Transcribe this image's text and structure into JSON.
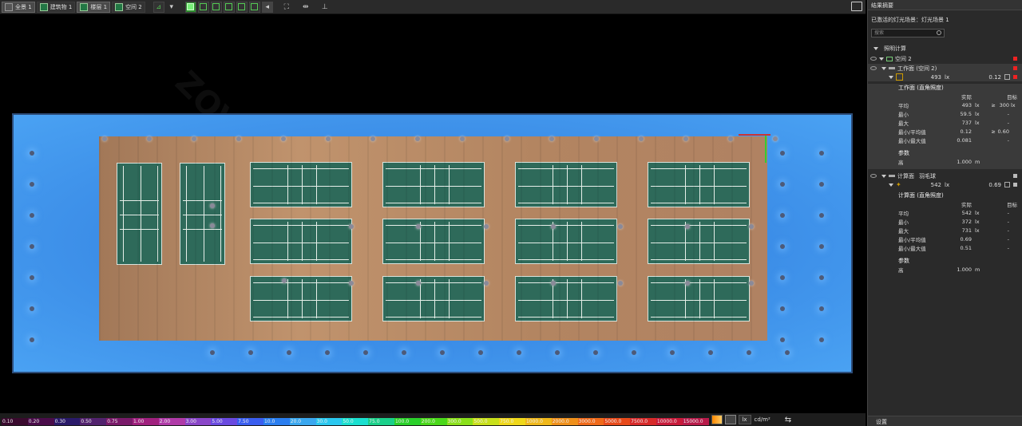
{
  "toolbar": {
    "items": [
      {
        "label": "全景 1"
      },
      {
        "label": "建筑物 1"
      },
      {
        "label": "楼层 1"
      },
      {
        "label": "空间 2"
      }
    ]
  },
  "panel": {
    "title": "结果摘要",
    "active_scene": "已激活的灯光场景：灯光场景 1",
    "search_placeholder": "搜索",
    "section": "照明计算",
    "space_name": "空间 2",
    "workplane": {
      "name": "工作面 (空间 2)",
      "summary_value": "493",
      "summary_unit": "lx",
      "summary_ratio": "0.12",
      "table_title": "工作面 (直角照度)",
      "col_actual": "实际",
      "col_target": "目标",
      "rows": [
        {
          "k": "平均",
          "v": "493",
          "u": "lx",
          "c": "≥",
          "t": "300",
          "tu": "lx"
        },
        {
          "k": "最小",
          "v": "59.5",
          "u": "lx",
          "c": "",
          "t": "-",
          "tu": ""
        },
        {
          "k": "最大",
          "v": "737",
          "u": "lx",
          "c": "",
          "t": "-",
          "tu": ""
        },
        {
          "k": "最小/平均值",
          "v": "0.12",
          "u": "",
          "c": "≥",
          "t": "0.60",
          "tu": ""
        },
        {
          "k": "最小/最大值",
          "v": "0.081",
          "u": "",
          "c": "",
          "t": "-",
          "tu": ""
        }
      ],
      "params_title": "参数",
      "height_label": "高",
      "height_value": "1.000",
      "height_unit": "m"
    },
    "calcplane": {
      "name": "计算面",
      "type": "羽毛球",
      "summary_value": "542",
      "summary_unit": "lx",
      "summary_ratio": "0.69",
      "table_title": "计算面 (直角照度)",
      "col_actual": "实际",
      "col_target": "目标",
      "rows": [
        {
          "k": "平均",
          "v": "542",
          "u": "lx",
          "c": "",
          "t": "-",
          "tu": ""
        },
        {
          "k": "最小",
          "v": "372",
          "u": "lx",
          "c": "",
          "t": "-",
          "tu": ""
        },
        {
          "k": "最大",
          "v": "731",
          "u": "lx",
          "c": "",
          "t": "-",
          "tu": ""
        },
        {
          "k": "最小/平均值",
          "v": "0.69",
          "u": "",
          "c": "",
          "t": "-",
          "tu": ""
        },
        {
          "k": "最小/最大值",
          "v": "0.51",
          "u": "",
          "c": "",
          "t": "-",
          "tu": ""
        }
      ],
      "params_title": "参数",
      "height_label": "高",
      "height_value": "1.000",
      "height_unit": "m"
    },
    "settings": "设置"
  },
  "legend": {
    "values": [
      "0.10",
      "0.20",
      "0.30",
      "0.50",
      "0.75",
      "1.00",
      "2.00",
      "3.00",
      "5.00",
      "7.50",
      "10.0",
      "20.0",
      "30.0",
      "50.0",
      "75.0",
      "100.0",
      "200.0",
      "300.0",
      "500.0",
      "750.0",
      "1000.0",
      "2000.0",
      "3000.0",
      "5000.0",
      "7500.0",
      "10000.0",
      "15000.0"
    ],
    "colors": [
      "#3a0a2e",
      "#4a0c4a",
      "#2a1a6a",
      "#52226e",
      "#7a1a6a",
      "#a0207e",
      "#b03aa8",
      "#8a46c8",
      "#6a4ae0",
      "#3a5ef0",
      "#2a7ef0",
      "#3aa8f0",
      "#2ac8f0",
      "#1ae0d0",
      "#1ad08a",
      "#2ad02a",
      "#4ad81a",
      "#8ae01a",
      "#c8e01a",
      "#f0d81a",
      "#f0b81a",
      "#f0901a",
      "#f06a1a",
      "#e84a1a",
      "#d82a2a",
      "#c81a3a",
      "#b81a4a"
    ],
    "unit_lx": "lx",
    "unit_cd": "cd/m²"
  }
}
